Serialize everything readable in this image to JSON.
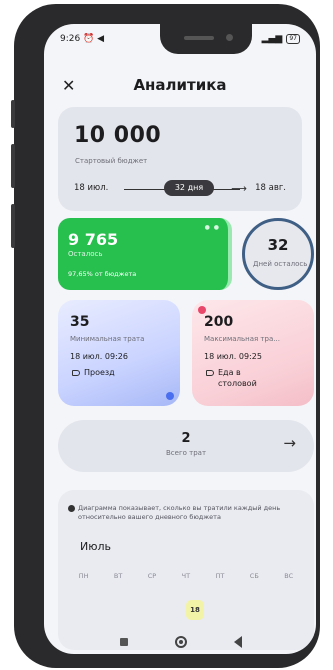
{
  "status_bar": {
    "time": "9:26",
    "battery": "97"
  },
  "header": {
    "title": "Аналитика"
  },
  "budget": {
    "amount": "10 000",
    "label": "Стартовый бюджет",
    "start_date": "18 июл.",
    "end_date": "18 авг.",
    "duration": "32 дня"
  },
  "remaining": {
    "value": "9 765",
    "label": "Осталось",
    "percent_text": "97,65% от бюджета",
    "color": "#27c04f"
  },
  "days_left": {
    "value": "32",
    "label": "Дней осталось"
  },
  "min_spend": {
    "value": "35",
    "label": "Минимальная трата",
    "date": "18 июл. 09:26",
    "category": "Проезд"
  },
  "max_spend": {
    "value": "200",
    "label": "Максимальная тра...",
    "date": "18 июл. 09:25",
    "category": "Еда в столовой"
  },
  "total_spends": {
    "value": "2",
    "label": "Всего трат"
  },
  "calendar": {
    "note": "Диаграмма показывает, сколько вы тратили каждый день относительно вашего дневного бюджета",
    "month": "Июль",
    "weekdays": [
      "ПН",
      "ВТ",
      "СР",
      "ЧТ",
      "ПТ",
      "СБ",
      "ВС"
    ],
    "highlighted_day": "18"
  }
}
